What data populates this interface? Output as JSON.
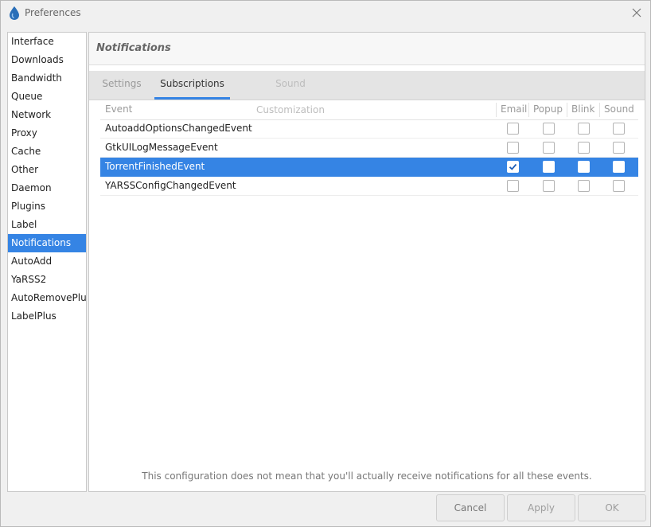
{
  "window": {
    "title": "Preferences"
  },
  "sidebar": {
    "items": [
      {
        "label": "Interface"
      },
      {
        "label": "Downloads"
      },
      {
        "label": "Bandwidth"
      },
      {
        "label": "Queue"
      },
      {
        "label": "Network"
      },
      {
        "label": "Proxy"
      },
      {
        "label": "Cache"
      },
      {
        "label": "Other"
      },
      {
        "label": "Daemon"
      },
      {
        "label": "Plugins"
      },
      {
        "label": "Label"
      },
      {
        "label": "Notifications",
        "selected": true
      },
      {
        "label": "AutoAdd"
      },
      {
        "label": "YaRSS2"
      },
      {
        "label": "AutoRemovePlus"
      },
      {
        "label": "LabelPlus"
      }
    ]
  },
  "content": {
    "header": "Notifications",
    "tabs": [
      {
        "label": "Settings"
      },
      {
        "label": "Subscriptions",
        "active": true
      },
      {
        "label": "Sound Customization",
        "disabled": true
      }
    ],
    "table": {
      "columns": [
        "Event",
        "Email",
        "Popup",
        "Blink",
        "Sound"
      ],
      "rows": [
        {
          "event": "AutoaddOptionsChangedEvent",
          "email": false,
          "popup": false,
          "blink": false,
          "sound": false
        },
        {
          "event": "GtkUILogMessageEvent",
          "email": false,
          "popup": false,
          "blink": false,
          "sound": false
        },
        {
          "event": "TorrentFinishedEvent",
          "email": true,
          "popup": false,
          "blink": false,
          "sound": false,
          "selected": true
        },
        {
          "event": "YARSSConfigChangedEvent",
          "email": false,
          "popup": false,
          "blink": false,
          "sound": false
        }
      ]
    },
    "footnote": "This configuration does not mean that you'll actually receive notifications for all these events."
  },
  "buttons": {
    "cancel": "Cancel",
    "apply": "Apply",
    "ok": "OK"
  },
  "colors": {
    "accent": "#3584e4",
    "app_icon": "#2a6fb8"
  },
  "icons": {
    "app": "deluge-drop-icon",
    "close": "close-icon",
    "check": "checkmark-icon"
  }
}
